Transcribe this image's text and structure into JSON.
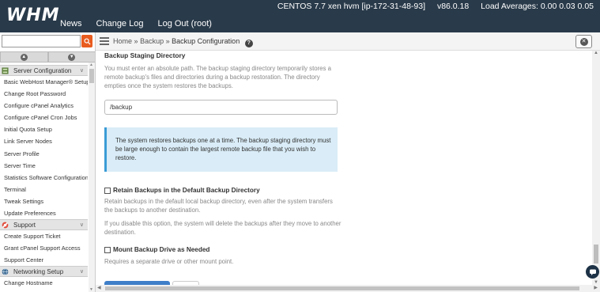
{
  "header": {
    "logo": "WHM",
    "nav": [
      "News",
      "Change Log",
      "Log Out (root)"
    ],
    "system": {
      "os": "CENTOS 7.7 xen hvm [ip-172-31-48-93]",
      "version": "v86.0.18",
      "load": "Load Averages: 0.00 0.03 0.05"
    }
  },
  "sidebar": {
    "search": {
      "value": "",
      "placeholder": ""
    },
    "groups": [
      {
        "label": "Server Configuration",
        "items": [
          "Basic WebHost Manager® Setup",
          "Change Root Password",
          "Configure cPanel Analytics",
          "Configure cPanel Cron Jobs",
          "Initial Quota Setup",
          "Link Server Nodes",
          "Server Profile",
          "Server Time",
          "Statistics Software Configuration",
          "Terminal",
          "Tweak Settings",
          "Update Preferences"
        ]
      },
      {
        "label": "Support",
        "items": [
          "Create Support Ticket",
          "Grant cPanel Support Access",
          "Support Center"
        ]
      },
      {
        "label": "Networking Setup",
        "items": [
          "Change Hostname"
        ]
      }
    ]
  },
  "breadcrumb": {
    "home": "Home",
    "sep": "»",
    "section": "Backup",
    "current": "Backup Configuration",
    "help": "?"
  },
  "content": {
    "staging": {
      "heading": "Backup Staging Directory",
      "description": "You must enter an absolute path. The backup staging directory temporarily stores a remote backup's files and directories during a backup restoration. The directory empties once the system restores the backups.",
      "value": "/backup"
    },
    "info": "The system restores backups one at a time. The backup staging directory must be large enough to contain the largest remote backup file that you wish to restore.",
    "retain": {
      "label": "Retain Backups in the Default Backup Directory",
      "checked": false,
      "desc1": "Retain backups in the default local backup directory, even after the system transfers the backups to another destination.",
      "desc2": "If you disable this option, the system will delete the backups after they move to another destination."
    },
    "mount": {
      "label": "Mount Backup Drive as Needed",
      "checked": false,
      "desc": "Requires a separate drive or other mount point."
    }
  },
  "colors": {
    "header_bg": "#293a4a",
    "accent": "#e85c1f",
    "info_bg": "#d9ecf7",
    "primary_button": "#3f7fc9"
  },
  "icons": [
    "search-icon",
    "menu-icon",
    "help-icon",
    "close-icon",
    "chevron-up-icon",
    "chevron-down-icon",
    "chat-icon"
  ]
}
